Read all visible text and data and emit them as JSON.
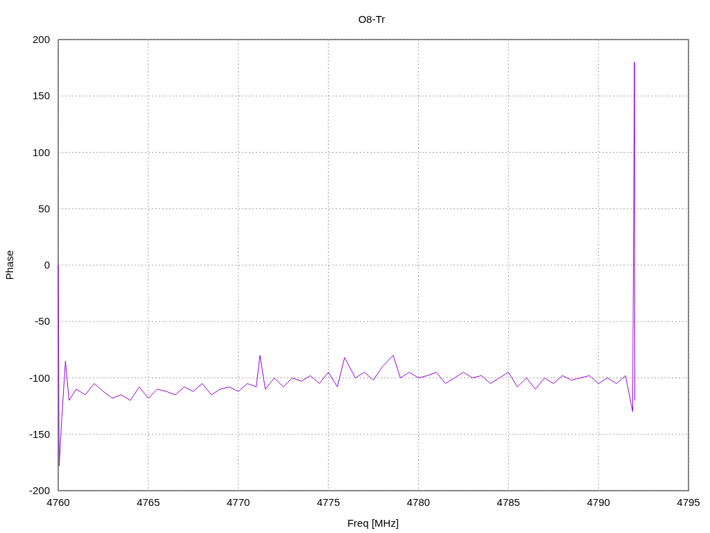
{
  "chart_data": {
    "type": "line",
    "title": "O8-Tr",
    "xlabel": "Freq [MHz]",
    "ylabel": "Phase",
    "grid": true,
    "xlim": [
      4760,
      4795
    ],
    "ylim": [
      -200,
      200
    ],
    "xticks": [
      4760,
      4765,
      4770,
      4775,
      4780,
      4785,
      4790,
      4795
    ],
    "yticks": [
      -200,
      -150,
      -100,
      -50,
      0,
      50,
      100,
      150,
      200
    ],
    "x": [
      4760,
      4760.05,
      4760.2,
      4760.4,
      4760.6,
      4761,
      4761.5,
      4762,
      4762.5,
      4763,
      4763.5,
      4764,
      4764.5,
      4765,
      4765.5,
      4766,
      4766.5,
      4767,
      4767.5,
      4768,
      4768.5,
      4769,
      4769.5,
      4770,
      4770.5,
      4771,
      4771.2,
      4771.5,
      4772,
      4772.5,
      4773,
      4773.5,
      4774,
      4774.5,
      4775,
      4775.5,
      4775.9,
      4776.5,
      4777,
      4777.5,
      4778,
      4778.6,
      4779,
      4779.5,
      4780,
      4780.5,
      4781,
      4781.5,
      4782,
      4782.5,
      4783,
      4783.5,
      4784,
      4784.5,
      4785,
      4785.5,
      4786,
      4786.5,
      4787,
      4787.5,
      4788,
      4788.5,
      4789,
      4789.5,
      4790,
      4790.5,
      4791,
      4791.5,
      4791.9,
      4791.95,
      4792,
      4792.02
    ],
    "series": [
      {
        "color": "#9400d3",
        "values": [
          0,
          -178,
          -135,
          -85,
          -120,
          -110,
          -115,
          -105,
          -112,
          -118,
          -115,
          -120,
          -108,
          -118,
          -110,
          -112,
          -115,
          -108,
          -112,
          -105,
          -115,
          -110,
          -108,
          -112,
          -105,
          -108,
          -80,
          -110,
          -100,
          -108,
          -100,
          -103,
          -98,
          -105,
          -95,
          -108,
          -82,
          -100,
          -95,
          -102,
          -90,
          -80,
          -100,
          -95,
          -100,
          -98,
          -95,
          -105,
          -100,
          -95,
          -100,
          -98,
          -105,
          -100,
          -95,
          -108,
          -100,
          -110,
          -100,
          -105,
          -98,
          -102,
          -100,
          -98,
          -105,
          -100,
          -105,
          -98,
          -130,
          30,
          180,
          -120
        ]
      }
    ]
  }
}
